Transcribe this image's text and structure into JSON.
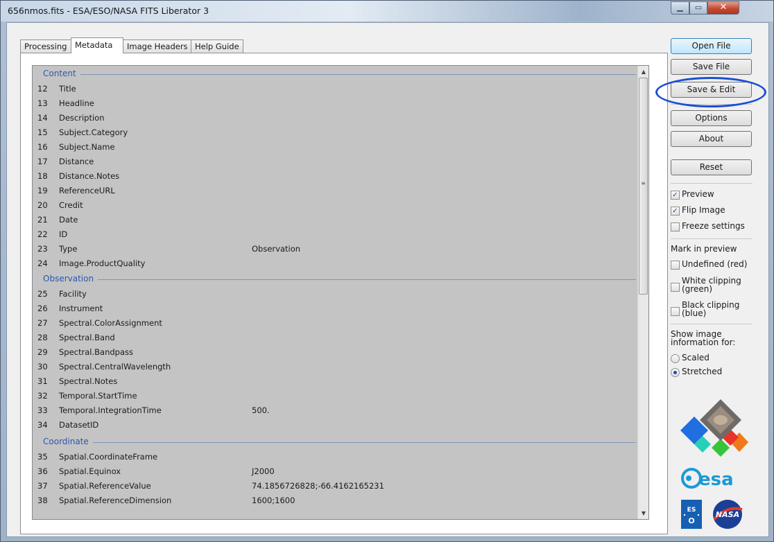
{
  "window": {
    "title": "656nmos.fits - ESA/ESO/NASA FITS Liberator 3"
  },
  "tabs": [
    {
      "label": "Processing"
    },
    {
      "label": "Metadata"
    },
    {
      "label": "Image Headers"
    },
    {
      "label": "Help Guide"
    }
  ],
  "sections": [
    {
      "title": "Content"
    },
    {
      "title": "Observation"
    },
    {
      "title": "Coordinate"
    }
  ],
  "rows": [
    {
      "num": "12",
      "name": "Title",
      "value": ""
    },
    {
      "num": "13",
      "name": "Headline",
      "value": ""
    },
    {
      "num": "14",
      "name": "Description",
      "value": ""
    },
    {
      "num": "15",
      "name": "Subject.Category",
      "value": ""
    },
    {
      "num": "16",
      "name": "Subject.Name",
      "value": ""
    },
    {
      "num": "17",
      "name": "Distance",
      "value": ""
    },
    {
      "num": "18",
      "name": "Distance.Notes",
      "value": ""
    },
    {
      "num": "19",
      "name": "ReferenceURL",
      "value": ""
    },
    {
      "num": "20",
      "name": "Credit",
      "value": ""
    },
    {
      "num": "21",
      "name": "Date",
      "value": ""
    },
    {
      "num": "22",
      "name": "ID",
      "value": ""
    },
    {
      "num": "23",
      "name": "Type",
      "value": "Observation"
    },
    {
      "num": "24",
      "name": "Image.ProductQuality",
      "value": ""
    },
    {
      "num": "25",
      "name": "Facility",
      "value": ""
    },
    {
      "num": "26",
      "name": "Instrument",
      "value": ""
    },
    {
      "num": "27",
      "name": "Spectral.ColorAssignment",
      "value": ""
    },
    {
      "num": "28",
      "name": "Spectral.Band",
      "value": ""
    },
    {
      "num": "29",
      "name": "Spectral.Bandpass",
      "value": ""
    },
    {
      "num": "30",
      "name": "Spectral.CentralWavelength",
      "value": ""
    },
    {
      "num": "31",
      "name": "Spectral.Notes",
      "value": ""
    },
    {
      "num": "32",
      "name": "Temporal.StartTime",
      "value": ""
    },
    {
      "num": "33",
      "name": "Temporal.IntegrationTime",
      "value": "500."
    },
    {
      "num": "34",
      "name": "DatasetID",
      "value": ""
    },
    {
      "num": "35",
      "name": "Spatial.CoordinateFrame",
      "value": ""
    },
    {
      "num": "36",
      "name": "Spatial.Equinox",
      "value": "J2000"
    },
    {
      "num": "37",
      "name": "Spatial.ReferenceValue",
      "value": "74.1856726828;-66.4162165231"
    },
    {
      "num": "38",
      "name": "Spatial.ReferenceDimension",
      "value": "1600;1600"
    }
  ],
  "buttons": {
    "open_file": "Open File",
    "save_file": "Save File",
    "save_edit": "Save & Edit",
    "options": "Options",
    "about": "About",
    "reset": "Reset"
  },
  "checks": {
    "preview": {
      "label": "Preview",
      "checked": true
    },
    "flip_image": {
      "label": "Flip Image",
      "checked": true
    },
    "freeze_settings": {
      "label": "Freeze settings",
      "checked": false
    }
  },
  "mark_in_preview": {
    "heading": "Mark in preview",
    "undefined": {
      "label": "Undefined (red)",
      "checked": false
    },
    "white_clipping": {
      "label_1": "White clipping",
      "label_2": "(green)",
      "checked": false
    },
    "black_clipping": {
      "label_1": "Black clipping",
      "label_2": "(blue)",
      "checked": false
    }
  },
  "image_info": {
    "heading_1": "Show image",
    "heading_2": "information for:",
    "scaled": "Scaled",
    "stretched": "Stretched",
    "selected": "Stretched"
  },
  "logos": {
    "esa": "esa",
    "eso": "ESO",
    "nasa": "NASA"
  },
  "colors": {
    "section_title": "#2c57b2",
    "annotation": "#1b4fd3",
    "close_button": "#c24a31"
  }
}
